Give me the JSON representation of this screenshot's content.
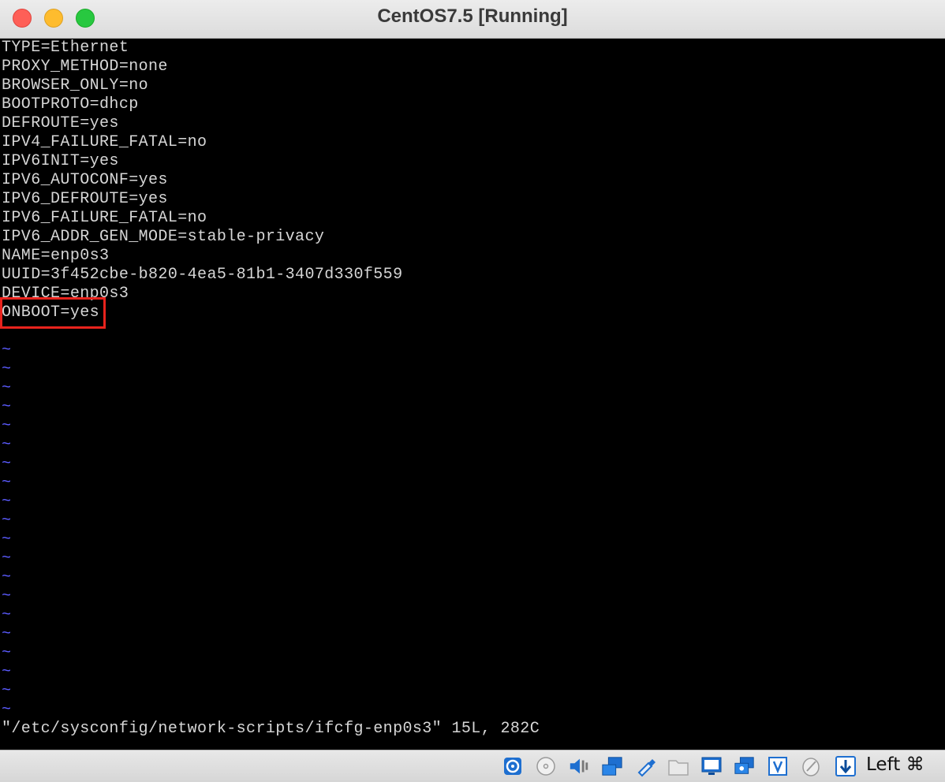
{
  "window": {
    "title": "CentOS7.5 [Running]"
  },
  "terminal": {
    "lines": [
      "TYPE=Ethernet",
      "PROXY_METHOD=none",
      "BROWSER_ONLY=no",
      "BOOTPROTO=dhcp",
      "DEFROUTE=yes",
      "IPV4_FAILURE_FATAL=no",
      "IPV6INIT=yes",
      "IPV6_AUTOCONF=yes",
      "IPV6_DEFROUTE=yes",
      "IPV6_FAILURE_FATAL=no",
      "IPV6_ADDR_GEN_MODE=stable-privacy",
      "NAME=enp0s3",
      "UUID=3f452cbe-b820-4ea5-81b1-3407d330f559",
      "DEVICE=enp0s3",
      "ONBOOT=yes"
    ],
    "tilde": "~",
    "tilde_count": 20,
    "status": "\"/etc/sysconfig/network-scripts/ifcfg-enp0s3\" 15L, 282C",
    "highlighted_line": "ONBOOT=yes",
    "highlight_color": "#e8231d",
    "text_color": "#d6d6d6",
    "tilde_color": "#5b5bff"
  },
  "statusbar": {
    "icons": [
      "hard-disk-icon",
      "optical-drive-icon",
      "audio-icon",
      "network-icon",
      "usb-icon",
      "shared-folders-icon",
      "display-icon",
      "video-capture-icon",
      "virtualization-icon",
      "mouse-integration-icon",
      "keyboard-capture-icon"
    ],
    "host_key": "Left ⌘"
  }
}
